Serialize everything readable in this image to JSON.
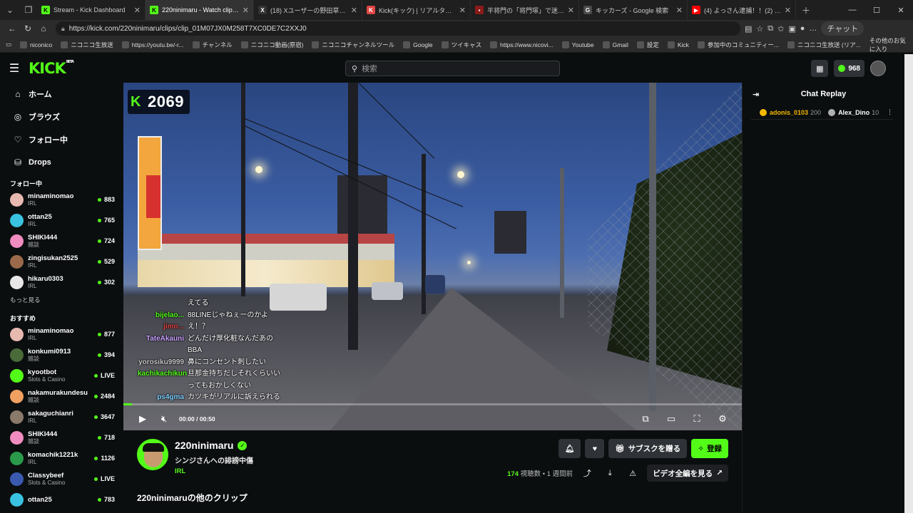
{
  "tabs": [
    {
      "label": "Stream - Kick Dashboard",
      "fav_color": "#53fc18",
      "fav_text": "K",
      "active": false
    },
    {
      "label": "220ninimaru - Watch clips on Kick",
      "fav_color": "#53fc18",
      "fav_text": "K",
      "active": true
    },
    {
      "label": "(18) Xユーザーの野田草履Pの裏アカ",
      "fav_color": "#333333",
      "fav_text": "X",
      "active": false
    },
    {
      "label": "Kick(キック) | リアルタイムランキング",
      "fav_color": "#e04545",
      "fav_text": "K",
      "active": false
    },
    {
      "label": "平将門の「将門塚」で迷惑行為 /",
      "fav_color": "#8b1a1a",
      "fav_text": "▪",
      "active": false
    },
    {
      "label": "キッカーズ - Google 検索",
      "fav_color": "#4a4a4a",
      "fav_text": "G",
      "active": false
    },
    {
      "label": "(4) よっさん逮捕！！(2) - YouTube",
      "fav_color": "#ff0000",
      "fav_text": "▶",
      "active": false
    }
  ],
  "address": {
    "url": "https://kick.com/220ninimaru/clips/clip_01M07JX0M258T7XC0DE7C2XXJ0",
    "chat_label": "チャット"
  },
  "bookmarks": [
    "niconico",
    "ニコニコ生放送",
    "https://youtu.be/-r...",
    "チャンネル",
    "ニコニコ動画(原宿)",
    "ニコニコチャンネルツール",
    "Google",
    "ツイキャス",
    "https://www.nicovi...",
    "Youtube",
    "Gmail",
    "設定",
    "Kick",
    "参加中のコミュニティー...",
    "ニコニコ生放送 (リア..."
  ],
  "bookmarks_more": "その他のお気に入り",
  "kick": {
    "logo": "KICK",
    "logo_beta": "BETA",
    "search_placeholder": "検索",
    "kicks_count": "968"
  },
  "sidebar": {
    "menu": [
      {
        "label": "ホーム",
        "icon": "home-icon",
        "glyph": "⌂"
      },
      {
        "label": "ブラウズ",
        "icon": "browse-icon",
        "glyph": "◎"
      },
      {
        "label": "フォロー中",
        "icon": "heart-icon",
        "glyph": "♡"
      },
      {
        "label": "Drops",
        "icon": "drops-icon",
        "glyph": "⛁"
      }
    ],
    "following_title": "フォロー中",
    "following": [
      {
        "name": "minaminomao",
        "cat": "IRL",
        "viewers": "883",
        "color": "#e8b9b0"
      },
      {
        "name": "ottan25",
        "cat": "IRL",
        "viewers": "765",
        "color": "#39c3e0"
      },
      {
        "name": "SHIKI444",
        "cat": "雑談",
        "viewers": "724",
        "color": "#f08cc0"
      },
      {
        "name": "zingisukan2525",
        "cat": "IRL",
        "viewers": "529",
        "color": "#9a6a4a"
      },
      {
        "name": "hikaru0303",
        "cat": "IRL",
        "viewers": "302",
        "color": "#e8e8e8"
      }
    ],
    "more_label": "もっと見る",
    "recommended_title": "おすすめ",
    "recommended": [
      {
        "name": "minaminomao",
        "cat": "IRL",
        "viewers": "877",
        "color": "#e8b9b0"
      },
      {
        "name": "konkumi0913",
        "cat": "雑談",
        "viewers": "394",
        "color": "#4a6a3a"
      },
      {
        "name": "kyootbot",
        "cat": "Slots & Casino",
        "viewers": "LIVE",
        "color": "#53fc18"
      },
      {
        "name": "nakamurakundesu",
        "cat": "雑談",
        "viewers": "2484",
        "color": "#f0a060"
      },
      {
        "name": "sakaguchianri",
        "cat": "IRL",
        "viewers": "3647",
        "color": "#8a7a6a"
      },
      {
        "name": "SHIKI444",
        "cat": "雑談",
        "viewers": "718",
        "color": "#f08cc0"
      },
      {
        "name": "komachik1221k",
        "cat": "IRL",
        "viewers": "1126",
        "color": "#2a9a4a"
      },
      {
        "name": "Classybeef",
        "cat": "Slots & Casino",
        "viewers": "LIVE",
        "color": "#3a5ab0"
      },
      {
        "name": "ottan25",
        "cat": "",
        "viewers": "783",
        "color": "#39c3e0"
      }
    ]
  },
  "video": {
    "viewer_count": "2069",
    "overlay_chat": [
      {
        "user": "",
        "color": "#ffffff",
        "msg": "えてる"
      },
      {
        "user": "bijelao...",
        "color": "#53fc18",
        "msg": "88LINEじゃねぇーのかよ"
      },
      {
        "user": "jimo...",
        "color": "#e04545",
        "msg": "え！？"
      },
      {
        "user": "TateAkauni",
        "color": "#c8a0ff",
        "msg": "どんだけ厚化粧なんだあの"
      },
      {
        "user": "",
        "color": "#ffffff",
        "msg": "BBA"
      },
      {
        "user": "yorosiku9999",
        "color": "#c8c8c8",
        "msg": "鼻にコンセント刺したい"
      },
      {
        "user": "kachikachikun",
        "color": "#53fc18",
        "msg": "旦那金持ちだしそれくらいい"
      },
      {
        "user": "",
        "color": "#ffffff",
        "msg": "ってもおかしくない"
      },
      {
        "user": "ps4gma",
        "color": "#7fd0ff",
        "msg": "カツキがリアルに訴えられる"
      }
    ],
    "progress_fraction": 0.014,
    "time_current": "00:00",
    "time_total": "00:50"
  },
  "chat_replay": {
    "title": "Chat Replay",
    "gifters": [
      {
        "name": "adonis_0103",
        "count": "200",
        "color": "#f5b800",
        "name_color": "#f5b800"
      },
      {
        "name": "Alex_Dino",
        "count": "10",
        "color": "#b0b0b0",
        "name_color": "#ffffff"
      }
    ]
  },
  "channel": {
    "name": "220ninimaru",
    "title": "シンジさんへの誹謗中傷",
    "category": "IRL",
    "gift_sub_label": "サブスクを贈る",
    "subscribe_label": "登録",
    "views": "174",
    "views_label": "視聴数",
    "time_ago": "1 週間前",
    "full_video_label": "ビデオ全編を見る",
    "other_clips": "220ninimaruの他のクリップ"
  }
}
